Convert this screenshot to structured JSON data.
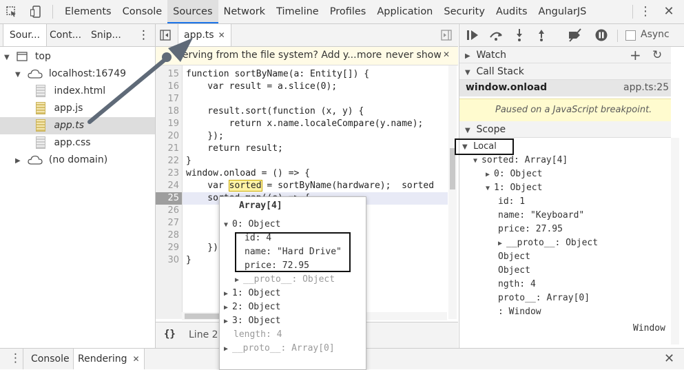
{
  "topbar": {
    "icons": [
      "inspect-icon",
      "device-icon",
      "more-icon",
      "close-icon"
    ],
    "tabs": [
      "Elements",
      "Console",
      "Sources",
      "Network",
      "Timeline",
      "Profiles",
      "Application",
      "Security",
      "Audits",
      "AngularJS"
    ],
    "active_tab": "Sources"
  },
  "navigator": {
    "tabs": [
      "Sour...",
      "Cont...",
      "Snip..."
    ],
    "tree": {
      "top": "top",
      "host": "localhost:16749",
      "files": [
        "index.html",
        "app.js",
        "app.ts",
        "app.css"
      ],
      "selected": "app.ts",
      "no_domain": "(no domain)"
    }
  },
  "editor": {
    "tab_label": "app.ts",
    "infobar": {
      "message": "Serving from the file system? Add y...",
      "more": "more",
      "never_show": "never show"
    },
    "lines": [
      {
        "n": "15",
        "code": "function sortByName(a: Entity[]) {"
      },
      {
        "n": "16",
        "code": "    var result = a.slice(0);"
      },
      {
        "n": "17",
        "code": ""
      },
      {
        "n": "18",
        "code": "    result.sort(function (x, y) {"
      },
      {
        "n": "19",
        "code": "        return x.name.localeCompare(y.name);"
      },
      {
        "n": "20",
        "code": "    });"
      },
      {
        "n": "21",
        "code": "    return result;"
      },
      {
        "n": "22",
        "code": "}"
      },
      {
        "n": "23",
        "code": "window.onload = () => {"
      },
      {
        "n": "24",
        "code": "    var sorted = sortByName(hardware);  sorted"
      },
      {
        "n": "25",
        "code": "    sorted.map((e) => {"
      },
      {
        "n": "26",
        "code": ""
      },
      {
        "n": "27",
        "code": ""
      },
      {
        "n": "28",
        "code": ""
      },
      {
        "n": "29",
        "code": "    })"
      },
      {
        "n": "30",
        "code": "}"
      }
    ],
    "highlight_word": "sorted",
    "status_braces": "{}",
    "status_text": "Line 21"
  },
  "sidebar": {
    "async_label": "Async",
    "watch_label": "Watch",
    "callstack_label": "Call Stack",
    "frame_name": "window.onload",
    "frame_loc": "app.ts:25",
    "paused_msg": "Paused on a JavaScript breakpoint.",
    "scope_label": "Scope",
    "local_label": "Local",
    "scope_rows": [
      {
        "text": "sorted: Array[4]"
      },
      {
        "text": "0: Object"
      },
      {
        "text": "1: Object"
      },
      {
        "text": "id: 1"
      },
      {
        "text": "name: \"Keyboard\""
      },
      {
        "text": "price: 27.95"
      },
      {
        "text": "__proto__: Object"
      },
      {
        "text": "Object"
      },
      {
        "text": "Object"
      },
      {
        "text": "ngth: 4"
      },
      {
        "text": "proto__: Array[0]"
      },
      {
        "text": ": Window"
      }
    ],
    "global_value": "Window"
  },
  "popover": {
    "title": "Array[4]",
    "rows": [
      "0: Object",
      "id: 4",
      "name: \"Hard Drive\"",
      "price: 72.95",
      "__proto__: Object",
      "1: Object",
      "2: Object",
      "3: Object",
      "length: 4",
      "__proto__: Array[0]"
    ]
  },
  "drawer": {
    "tabs": [
      "Console",
      "Rendering"
    ]
  },
  "colors": {
    "accent": "#1a73e8",
    "paused_bg": "#fffbcf",
    "arrow": "#5f6a78"
  }
}
